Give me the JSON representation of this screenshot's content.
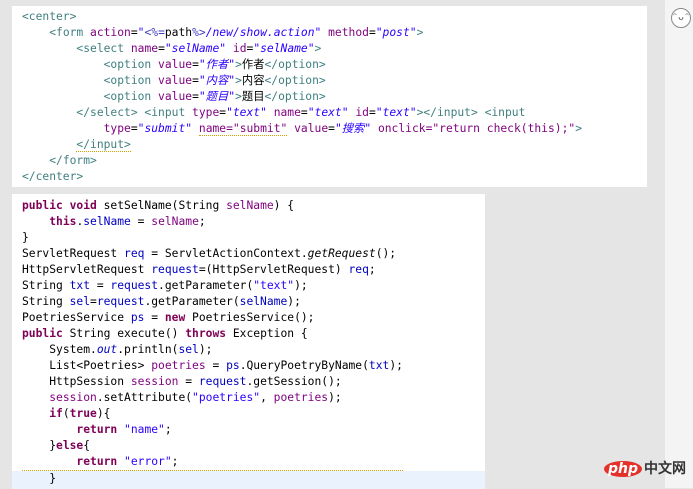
{
  "html_snippet": [
    {
      "indent": 0,
      "tokens": [
        {
          "t": "<center>",
          "c": "tag"
        }
      ]
    },
    {
      "indent": 1,
      "tokens": [
        {
          "t": "<form ",
          "c": "tag"
        },
        {
          "t": "action",
          "c": "at"
        },
        {
          "t": "=",
          "c": "pl"
        },
        {
          "t": "\"",
          "c": "str"
        },
        {
          "t": "<%=",
          "c": "jsp"
        },
        {
          "t": "path",
          "c": "pl"
        },
        {
          "t": "%>",
          "c": "jsp"
        },
        {
          "t": "/new/show.action\"",
          "c": "str"
        },
        {
          "t": " method",
          "c": "at"
        },
        {
          "t": "=",
          "c": "pl"
        },
        {
          "t": "\"post\"",
          "c": "str"
        },
        {
          "t": ">",
          "c": "tag"
        }
      ]
    },
    {
      "indent": 2,
      "tokens": [
        {
          "t": "<select ",
          "c": "tag"
        },
        {
          "t": "name",
          "c": "at"
        },
        {
          "t": "=",
          "c": "pl"
        },
        {
          "t": "\"selName\"",
          "c": "str"
        },
        {
          "t": " id",
          "c": "at"
        },
        {
          "t": "=",
          "c": "pl"
        },
        {
          "t": "\"selName\"",
          "c": "str"
        },
        {
          "t": ">",
          "c": "tag"
        }
      ]
    },
    {
      "indent": 3,
      "tokens": [
        {
          "t": "<option ",
          "c": "tag"
        },
        {
          "t": "value",
          "c": "at"
        },
        {
          "t": "=",
          "c": "pl"
        },
        {
          "t": "\"作者\"",
          "c": "str"
        },
        {
          "t": ">",
          "c": "tag"
        },
        {
          "t": "作者",
          "c": "pl"
        },
        {
          "t": "</option>",
          "c": "tag"
        }
      ]
    },
    {
      "indent": 3,
      "tokens": [
        {
          "t": "<option ",
          "c": "tag"
        },
        {
          "t": "value",
          "c": "at"
        },
        {
          "t": "=",
          "c": "pl"
        },
        {
          "t": "\"内容\"",
          "c": "str"
        },
        {
          "t": ">",
          "c": "tag"
        },
        {
          "t": "内容",
          "c": "pl"
        },
        {
          "t": "</option>",
          "c": "tag"
        }
      ]
    },
    {
      "indent": 3,
      "tokens": [
        {
          "t": "<option ",
          "c": "tag"
        },
        {
          "t": "value",
          "c": "at"
        },
        {
          "t": "=",
          "c": "pl"
        },
        {
          "t": "\"题目\"",
          "c": "str"
        },
        {
          "t": ">",
          "c": "tag"
        },
        {
          "t": "题目",
          "c": "pl"
        },
        {
          "t": "</option>",
          "c": "tag"
        }
      ]
    },
    {
      "indent": 2,
      "tokens": [
        {
          "t": "</select> <input ",
          "c": "tag"
        },
        {
          "t": "type",
          "c": "at"
        },
        {
          "t": "=",
          "c": "pl"
        },
        {
          "t": "\"text\"",
          "c": "str"
        },
        {
          "t": " name",
          "c": "at"
        },
        {
          "t": "=",
          "c": "pl"
        },
        {
          "t": "\"text\"",
          "c": "str"
        },
        {
          "t": " id",
          "c": "at"
        },
        {
          "t": "=",
          "c": "pl"
        },
        {
          "t": "\"text\"",
          "c": "str"
        },
        {
          "t": "></input> <input",
          "c": "tag"
        }
      ]
    },
    {
      "indent": 3,
      "tokens": [
        {
          "t": "type",
          "c": "at"
        },
        {
          "t": "=",
          "c": "pl"
        },
        {
          "t": "\"submit\"",
          "c": "str"
        },
        {
          "t": " ",
          "c": "pl"
        },
        {
          "t": "name=\"submit\"",
          "c": "at warn"
        },
        {
          "t": " value",
          "c": "at"
        },
        {
          "t": "=",
          "c": "pl"
        },
        {
          "t": "\"搜索\"",
          "c": "str"
        },
        {
          "t": " onclick",
          "c": "at"
        },
        {
          "t": "=\"return check(this);\"",
          "c": "at"
        },
        {
          "t": ">",
          "c": "tag"
        }
      ]
    },
    {
      "indent": 2,
      "tokens": [
        {
          "t": "</input>",
          "c": "tag warn"
        }
      ]
    },
    {
      "indent": 1,
      "tokens": [
        {
          "t": "</form>",
          "c": "tag"
        }
      ]
    },
    {
      "indent": 0,
      "tokens": [
        {
          "t": "</center>",
          "c": "tag"
        }
      ]
    }
  ],
  "java_snippet": [
    {
      "indent": 0,
      "tokens": [
        {
          "t": "public void ",
          "c": "kw"
        },
        {
          "t": "setSelName(String ",
          "c": "pl"
        },
        {
          "t": "selName",
          "c": "at"
        },
        {
          "t": ") {",
          "c": "pl"
        }
      ]
    },
    {
      "indent": 1,
      "tokens": [
        {
          "t": "this",
          "c": "kw"
        },
        {
          "t": ".",
          "c": "pl"
        },
        {
          "t": "selName",
          "c": "fld"
        },
        {
          "t": " = ",
          "c": "pl"
        },
        {
          "t": "selName",
          "c": "at"
        },
        {
          "t": ";",
          "c": "pl"
        }
      ]
    },
    {
      "indent": 0,
      "tokens": [
        {
          "t": "}",
          "c": "pl"
        }
      ]
    },
    {
      "indent": 0,
      "tokens": [
        {
          "t": "ServletRequest ",
          "c": "pl"
        },
        {
          "t": "req",
          "c": "fld"
        },
        {
          "t": " = ServletActionContext.",
          "c": "pl"
        },
        {
          "t": "getRequest",
          "c": "pl it"
        },
        {
          "t": "();",
          "c": "pl"
        }
      ]
    },
    {
      "indent": 0,
      "tokens": [
        {
          "t": "HttpServletRequest ",
          "c": "pl"
        },
        {
          "t": "request",
          "c": "fld"
        },
        {
          "t": "=(HttpServletRequest) ",
          "c": "pl"
        },
        {
          "t": "req",
          "c": "fld"
        },
        {
          "t": ";",
          "c": "pl"
        }
      ]
    },
    {
      "indent": 0,
      "tokens": [
        {
          "t": "String ",
          "c": "pl"
        },
        {
          "t": "txt",
          "c": "fld"
        },
        {
          "t": " = ",
          "c": "pl"
        },
        {
          "t": "request",
          "c": "fld"
        },
        {
          "t": ".getParameter(",
          "c": "pl"
        },
        {
          "t": "\"text\"",
          "c": "jstr"
        },
        {
          "t": ");",
          "c": "pl"
        }
      ]
    },
    {
      "indent": 0,
      "tokens": [
        {
          "t": "String ",
          "c": "pl"
        },
        {
          "t": "sel",
          "c": "fld"
        },
        {
          "t": "=",
          "c": "pl"
        },
        {
          "t": "request",
          "c": "fld"
        },
        {
          "t": ".getParameter(",
          "c": "pl"
        },
        {
          "t": "selName",
          "c": "fld"
        },
        {
          "t": ");",
          "c": "pl"
        }
      ]
    },
    {
      "indent": 0,
      "tokens": [
        {
          "t": "PoetriesService ",
          "c": "pl"
        },
        {
          "t": "ps",
          "c": "fld"
        },
        {
          "t": " = ",
          "c": "pl"
        },
        {
          "t": "new",
          "c": "kw"
        },
        {
          "t": " PoetriesService();",
          "c": "pl"
        }
      ]
    },
    {
      "indent": 0,
      "tokens": [
        {
          "t": "public",
          "c": "kw"
        },
        {
          "t": " String execute() ",
          "c": "pl"
        },
        {
          "t": "throws",
          "c": "kw"
        },
        {
          "t": " Exception {",
          "c": "pl"
        }
      ]
    },
    {
      "indent": 1,
      "tokens": [
        {
          "t": "System.",
          "c": "pl"
        },
        {
          "t": "out",
          "c": "sst"
        },
        {
          "t": ".println(",
          "c": "pl"
        },
        {
          "t": "sel",
          "c": "fld"
        },
        {
          "t": ");",
          "c": "pl"
        }
      ]
    },
    {
      "indent": 1,
      "tokens": [
        {
          "t": "List<Poetries> ",
          "c": "pl"
        },
        {
          "t": "poetries",
          "c": "at"
        },
        {
          "t": " = ",
          "c": "pl"
        },
        {
          "t": "ps",
          "c": "fld"
        },
        {
          "t": ".QueryPoetryByName(",
          "c": "pl"
        },
        {
          "t": "txt",
          "c": "fld"
        },
        {
          "t": ");",
          "c": "pl"
        }
      ]
    },
    {
      "indent": 1,
      "tokens": [
        {
          "t": "HttpSession ",
          "c": "pl"
        },
        {
          "t": "session",
          "c": "at"
        },
        {
          "t": " = ",
          "c": "pl"
        },
        {
          "t": "request",
          "c": "fld"
        },
        {
          "t": ".getSession();",
          "c": "pl"
        }
      ]
    },
    {
      "indent": 1,
      "tokens": [
        {
          "t": "session",
          "c": "at"
        },
        {
          "t": ".setAttribute(",
          "c": "pl"
        },
        {
          "t": "\"poetries\"",
          "c": "jstr"
        },
        {
          "t": ", ",
          "c": "pl"
        },
        {
          "t": "poetries",
          "c": "at"
        },
        {
          "t": ");",
          "c": "pl"
        }
      ]
    },
    {
      "indent": 1,
      "tokens": [
        {
          "t": "if",
          "c": "kw"
        },
        {
          "t": "(",
          "c": "pl"
        },
        {
          "t": "true",
          "c": "kw"
        },
        {
          "t": "){",
          "c": "pl"
        }
      ]
    },
    {
      "indent": 2,
      "tokens": [
        {
          "t": "return",
          "c": "kw"
        },
        {
          "t": " ",
          "c": "pl"
        },
        {
          "t": "\"name\"",
          "c": "jstr"
        },
        {
          "t": ";",
          "c": "pl"
        }
      ]
    },
    {
      "indent": 1,
      "tokens": [
        {
          "t": "}",
          "c": "pl"
        },
        {
          "t": "else",
          "c": "kw"
        },
        {
          "t": "{",
          "c": "pl"
        }
      ]
    },
    {
      "indent": 2,
      "tokens": [
        {
          "t": "return",
          "c": "kw"
        },
        {
          "t": " ",
          "c": "pl"
        },
        {
          "t": "\"error\"",
          "c": "jstr"
        },
        {
          "t": ";",
          "c": "pl"
        }
      ],
      "warn": true
    },
    {
      "indent": 1,
      "tokens": [
        {
          "t": "}",
          "c": "pl"
        }
      ],
      "highlight": true
    }
  ],
  "watermark": {
    "php": "php",
    "cn": "中文网"
  },
  "emoji_icon": "grinning-face-icon"
}
